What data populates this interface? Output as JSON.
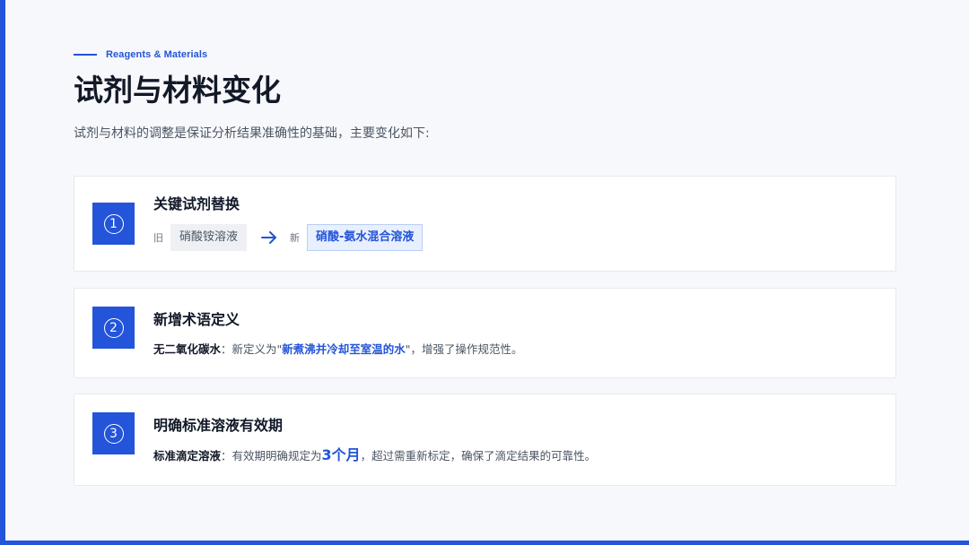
{
  "header": {
    "eyebrow": "Reagents & Materials",
    "title": "试剂与材料变化",
    "subtitle": "试剂与材料的调整是保证分析结果准确性的基础，主要变化如下:"
  },
  "cards": [
    {
      "number": "1",
      "title": "关键试剂替换",
      "old_label": "旧",
      "old_value": "硝酸铵溶液",
      "new_label": "新",
      "new_value": "硝酸-氨水混合溶液"
    },
    {
      "number": "2",
      "title": "新增术语定义",
      "lead": "无二氧化碳水",
      "text_before": "：新定义为\"",
      "highlight": "新煮沸并冷却至室温的水",
      "text_after": "\"，增强了操作规范性。"
    },
    {
      "number": "3",
      "title": "明确标准溶液有效期",
      "lead": "标准滴定溶液",
      "text_before": "：有效期明确规定为",
      "highlight": "3个月",
      "text_after": "，超过需重新标定，确保了滴定结果的可靠性。"
    }
  ],
  "icons": {
    "arrow": "arrow-right-icon"
  },
  "colors": {
    "accent": "#2354d9",
    "background": "#f7f8fb",
    "card": "#ffffff"
  }
}
